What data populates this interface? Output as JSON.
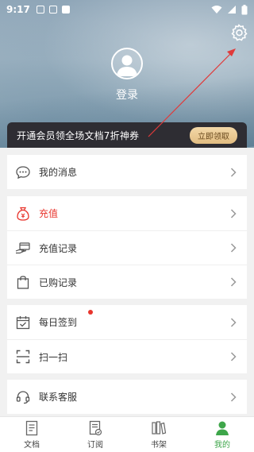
{
  "status_bar": {
    "time": "9:17"
  },
  "profile": {
    "login_label": "登录"
  },
  "vip_banner": {
    "text": "开通会员领全场文档7折神券",
    "button_label": "立即领取"
  },
  "groups": [
    {
      "items": [
        {
          "label": "我的消息",
          "icon": "message-icon"
        }
      ]
    },
    {
      "items": [
        {
          "label": "充值",
          "icon": "money-bag-icon",
          "highlight": true
        },
        {
          "label": "充值记录",
          "icon": "card-hand-icon"
        },
        {
          "label": "已购记录",
          "icon": "shopping-bag-icon"
        }
      ]
    },
    {
      "items": [
        {
          "label": "每日签到",
          "icon": "calendar-check-icon",
          "badge": "red-dot"
        },
        {
          "label": "扫一扫",
          "icon": "scan-icon"
        }
      ]
    },
    {
      "items": [
        {
          "label": "联系客服",
          "icon": "headset-icon"
        }
      ]
    }
  ],
  "tabbar": {
    "tabs": [
      {
        "label": "文档",
        "icon": "document-icon"
      },
      {
        "label": "订阅",
        "icon": "subscribe-icon"
      },
      {
        "label": "书架",
        "icon": "bookshelf-icon"
      },
      {
        "label": "我的",
        "icon": "person-icon",
        "active": true
      }
    ]
  },
  "colors": {
    "accent": "#3ea64a",
    "highlight_red": "#e8352d",
    "banner_bg": "#2e2d33",
    "banner_button": "#e2bd82"
  }
}
